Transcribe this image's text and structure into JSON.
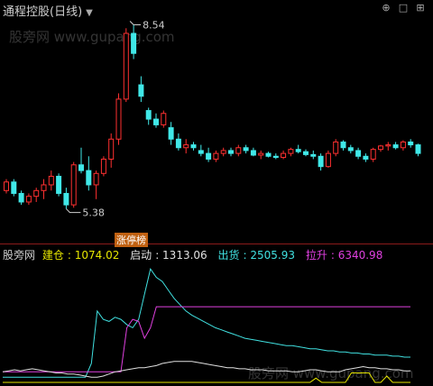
{
  "header": {
    "title": "通程控股(日线)",
    "dropdown_icon": "chevron-down-icon",
    "toolbar_icons": [
      "circle-plus-icon",
      "square-icon",
      "grid-icon"
    ]
  },
  "watermark": "股旁网 www.gupang.com",
  "badge_label": "涨停榜",
  "legend": {
    "name": "股旁网",
    "items": [
      {
        "label": "建仓",
        "value": "1074.02",
        "color": "#e6e600"
      },
      {
        "label": "启动",
        "value": "1313.06",
        "color": "#e0e0e0"
      },
      {
        "label": "出货",
        "value": "2505.93",
        "color": "#40e0e0"
      },
      {
        "label": "拉升",
        "value": "6340.98",
        "color": "#e040e0"
      }
    ]
  },
  "chart_data": [
    {
      "type": "candlestick",
      "title": "通程控股(日线)",
      "ylim": [
        4.9,
        8.75
      ],
      "annotations": [
        {
          "label": "8.54",
          "kind": "high"
        },
        {
          "label": "5.38",
          "kind": "low"
        }
      ],
      "candles": [
        [
          5.7,
          5.9,
          5.65,
          5.85
        ],
        [
          5.85,
          5.9,
          5.6,
          5.65
        ],
        [
          5.65,
          5.7,
          5.45,
          5.5
        ],
        [
          5.5,
          5.65,
          5.45,
          5.6
        ],
        [
          5.6,
          5.75,
          5.5,
          5.7
        ],
        [
          5.7,
          5.9,
          5.55,
          5.8
        ],
        [
          5.8,
          6.05,
          5.7,
          5.95
        ],
        [
          5.95,
          6.0,
          5.6,
          5.65
        ],
        [
          5.65,
          5.75,
          5.38,
          5.45
        ],
        [
          5.45,
          6.2,
          5.4,
          6.15
        ],
        [
          6.15,
          6.45,
          6.0,
          6.05
        ],
        [
          6.05,
          6.3,
          5.7,
          5.8
        ],
        [
          5.8,
          6.05,
          5.55,
          6.0
        ],
        [
          6.0,
          6.3,
          5.95,
          6.25
        ],
        [
          6.25,
          6.7,
          6.1,
          6.6
        ],
        [
          6.6,
          7.4,
          6.5,
          7.3
        ],
        [
          7.3,
          8.54,
          7.25,
          8.45
        ],
        [
          8.45,
          8.6,
          8.0,
          8.1
        ],
        [
          7.55,
          7.7,
          7.25,
          7.35
        ],
        [
          7.1,
          7.15,
          6.85,
          6.95
        ],
        [
          6.95,
          7.05,
          6.8,
          6.85
        ],
        [
          6.85,
          7.1,
          6.8,
          7.05
        ],
        [
          6.8,
          6.9,
          6.5,
          6.6
        ],
        [
          6.6,
          6.7,
          6.4,
          6.45
        ],
        [
          6.45,
          6.6,
          6.35,
          6.5
        ],
        [
          6.5,
          6.55,
          6.4,
          6.45
        ],
        [
          6.4,
          6.5,
          6.3,
          6.35
        ],
        [
          6.35,
          6.45,
          6.2,
          6.25
        ],
        [
          6.25,
          6.4,
          6.2,
          6.35
        ],
        [
          6.35,
          6.45,
          6.3,
          6.4
        ],
        [
          6.4,
          6.45,
          6.3,
          6.35
        ],
        [
          6.35,
          6.5,
          6.3,
          6.45
        ],
        [
          6.45,
          6.5,
          6.35,
          6.4
        ],
        [
          6.4,
          6.45,
          6.3,
          6.32
        ],
        [
          6.32,
          6.4,
          6.25,
          6.35
        ],
        [
          6.35,
          6.38,
          6.28,
          6.3
        ],
        [
          6.3,
          6.35,
          6.25,
          6.28
        ],
        [
          6.28,
          6.4,
          6.25,
          6.35
        ],
        [
          6.35,
          6.45,
          6.3,
          6.42
        ],
        [
          6.42,
          6.5,
          6.35,
          6.38
        ],
        [
          6.38,
          6.42,
          6.3,
          6.33
        ],
        [
          6.33,
          6.4,
          6.25,
          6.3
        ],
        [
          6.3,
          6.35,
          6.05,
          6.12
        ],
        [
          6.12,
          6.4,
          6.1,
          6.35
        ],
        [
          6.35,
          6.6,
          6.3,
          6.55
        ],
        [
          6.55,
          6.58,
          6.4,
          6.45
        ],
        [
          6.45,
          6.5,
          6.35,
          6.4
        ],
        [
          6.4,
          6.45,
          6.25,
          6.3
        ],
        [
          6.3,
          6.35,
          6.2,
          6.25
        ],
        [
          6.25,
          6.45,
          6.2,
          6.42
        ],
        [
          6.42,
          6.5,
          6.38,
          6.48
        ],
        [
          6.48,
          6.55,
          6.4,
          6.5
        ],
        [
          6.5,
          6.55,
          6.42,
          6.45
        ],
        [
          6.45,
          6.58,
          6.4,
          6.55
        ],
        [
          6.55,
          6.6,
          6.45,
          6.5
        ],
        [
          6.5,
          6.52,
          6.3,
          6.35
        ]
      ]
    },
    {
      "type": "line",
      "series": [
        {
          "name": "出货",
          "color": "#40e0e0",
          "values": [
            5,
            5,
            5,
            5,
            5,
            5,
            5,
            5,
            5,
            5,
            5,
            5,
            5,
            5,
            5,
            18,
            68,
            60,
            58,
            62,
            60,
            55,
            52,
            60,
            84,
            108,
            100,
            96,
            88,
            80,
            74,
            68,
            64,
            61,
            58,
            55,
            52,
            50,
            48,
            46,
            44,
            42,
            41,
            40,
            39,
            38,
            37,
            36,
            35,
            35,
            34,
            33,
            32,
            32,
            31,
            30,
            30,
            29,
            29,
            28,
            28,
            27,
            27,
            26,
            26,
            26,
            25,
            25,
            24,
            24
          ]
        },
        {
          "name": "拉升",
          "color": "#e040e0",
          "values": [
            10,
            10,
            10,
            10,
            10,
            10,
            10,
            10,
            10,
            10,
            10,
            10,
            10,
            10,
            10,
            10,
            10,
            10,
            10,
            10,
            10,
            52,
            60,
            58,
            42,
            52,
            72,
            72,
            72,
            72,
            72,
            72,
            72,
            72,
            72,
            72,
            72,
            72,
            72,
            72,
            72,
            72,
            72,
            72,
            72,
            72,
            72,
            72,
            72,
            72,
            72,
            72,
            72,
            72,
            72,
            72,
            72,
            72,
            72,
            72,
            72,
            72,
            72,
            72,
            72,
            72,
            72,
            72,
            72,
            72
          ]
        },
        {
          "name": "启动",
          "color": "#e0e0e0",
          "values": [
            10,
            11,
            12,
            11,
            12,
            13,
            12,
            11,
            10,
            9,
            9,
            8,
            8,
            7,
            6,
            5,
            5,
            6,
            8,
            10,
            11,
            12,
            13,
            14,
            14,
            15,
            16,
            18,
            19,
            20,
            20,
            20,
            20,
            19,
            18,
            17,
            16,
            15,
            14,
            14,
            13,
            13,
            12,
            12,
            12,
            11,
            11,
            11,
            11,
            10,
            10,
            11,
            12,
            12,
            11,
            10,
            10,
            10,
            12,
            13,
            14,
            15,
            14,
            14,
            13,
            13,
            12,
            12,
            11,
            11
          ]
        },
        {
          "name": "建仓",
          "color": "#e6e600",
          "values": [
            0,
            0,
            0,
            0,
            0,
            0,
            0,
            0,
            0,
            0,
            0,
            0,
            0,
            0,
            0,
            0,
            0,
            0,
            0,
            0,
            0,
            0,
            0,
            0,
            0,
            0,
            0,
            0,
            0,
            0,
            0,
            0,
            0,
            0,
            0,
            0,
            0,
            0,
            0,
            0,
            0,
            0,
            0,
            0,
            0,
            0,
            0,
            0,
            0,
            0,
            0,
            0,
            0,
            4,
            0,
            0,
            0,
            0,
            0,
            9,
            9,
            9,
            9,
            0,
            0,
            6,
            0,
            0,
            0,
            0
          ]
        }
      ],
      "ylim": [
        0,
        115
      ]
    }
  ]
}
